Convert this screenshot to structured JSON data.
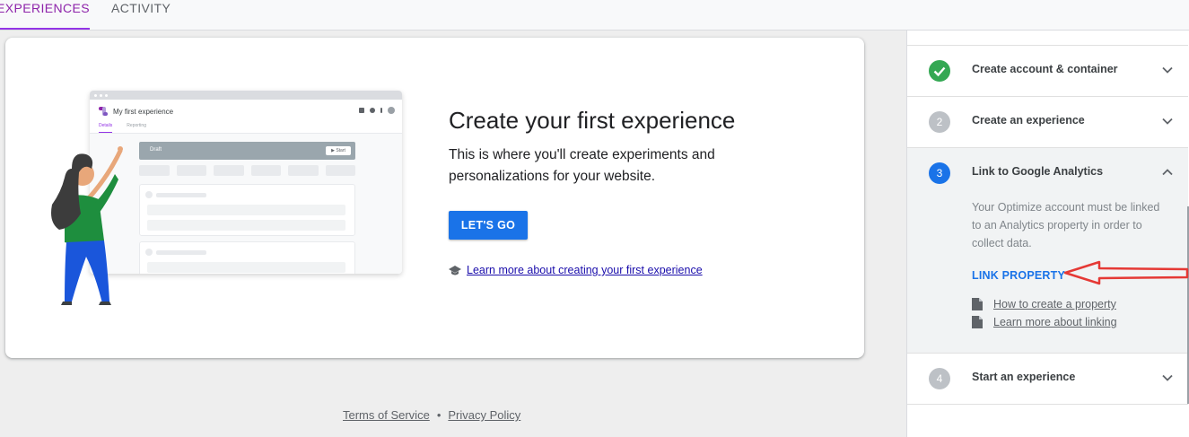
{
  "tabs": {
    "experiences": "EXPERIENCES",
    "activity": "ACTIVITY"
  },
  "mock": {
    "title": "My first experience",
    "subtab_details": "Details",
    "subtab_reporting": "Reporting",
    "draft": "Draft",
    "start": "▶ Start"
  },
  "hero": {
    "title": "Create your first experience",
    "description": "This is where you'll create experiments and personalizations for your website.",
    "cta": "LET'S GO",
    "learn_more": "Learn more about creating your first experience"
  },
  "footer": {
    "terms": "Terms of Service",
    "separator": "•",
    "privacy": "Privacy Policy"
  },
  "steps": [
    {
      "number": "",
      "title": "Create account & container",
      "state": "complete",
      "color": "#34a853"
    },
    {
      "number": "2",
      "title": "Create an experience",
      "state": "pending",
      "color": "#bdc1c6"
    },
    {
      "number": "3",
      "title": "Link to Google Analytics",
      "state": "active",
      "color": "#1a73e8",
      "description": "Your Optimize account must be linked to an Analytics property in order to collect data.",
      "action": "LINK PROPERTY",
      "links": [
        "How to create a property",
        "Learn more about linking"
      ]
    },
    {
      "number": "4",
      "title": "Start an experience",
      "state": "pending",
      "color": "#bdc1c6"
    }
  ],
  "colors": {
    "accent": "#1a73e8",
    "tab_active": "#9334e6",
    "annotation_arrow": "#e53935"
  }
}
